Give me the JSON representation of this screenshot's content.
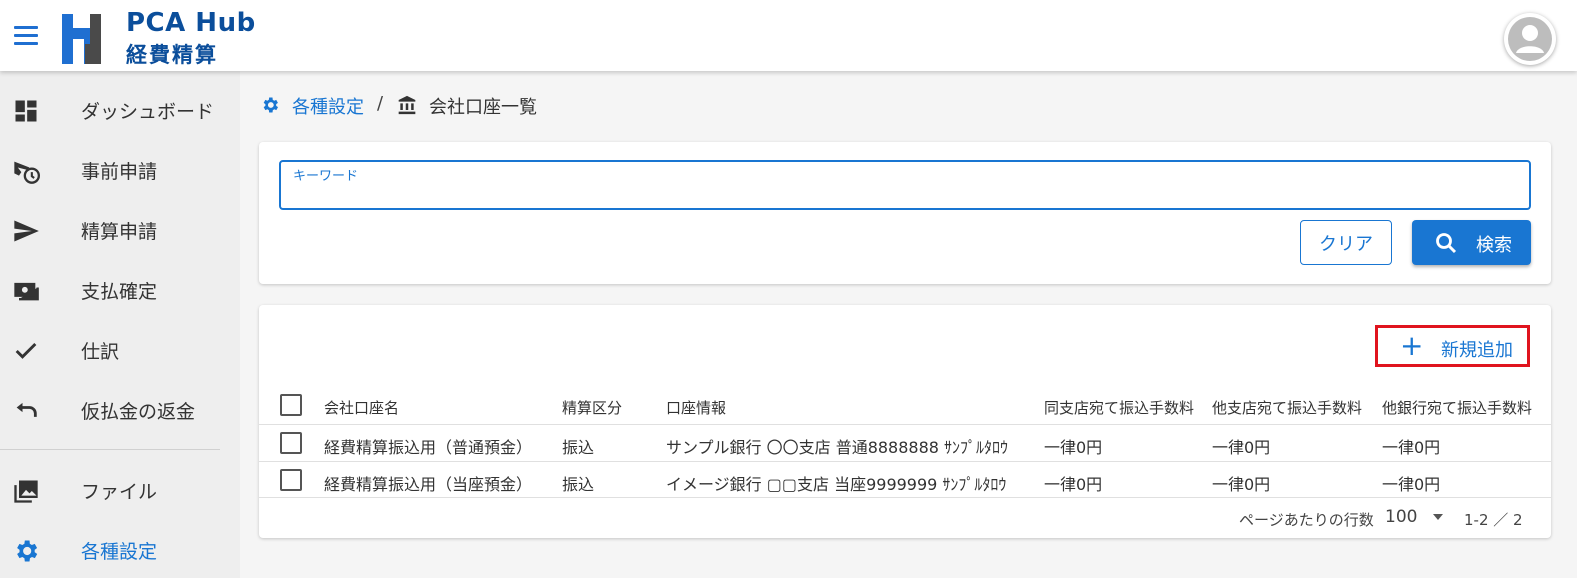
{
  "header": {
    "logo_line1": "PCA Hub",
    "logo_line2": "経費精算",
    "brand_color": "#0b4e9b"
  },
  "sidebar": {
    "items": [
      {
        "label": "ダッシュボード",
        "icon": "dashboard-icon"
      },
      {
        "label": "事前申請",
        "icon": "send-clock-icon"
      },
      {
        "label": "精算申請",
        "icon": "send-icon"
      },
      {
        "label": "支払確定",
        "icon": "payments-icon"
      },
      {
        "label": "仕訳",
        "icon": "check-icon"
      },
      {
        "label": "仮払金の返金",
        "icon": "undo-icon"
      },
      {
        "label": "ファイル",
        "icon": "photo-library-icon"
      },
      {
        "label": "各種設定",
        "icon": "gear-icon",
        "active": true
      }
    ]
  },
  "breadcrumb": {
    "parent": "各種設定",
    "separator": "/",
    "current": "会社口座一覧"
  },
  "search": {
    "keyword_label": "キーワード",
    "keyword_value": "",
    "clear_label": "クリア",
    "search_label": "検索"
  },
  "table": {
    "add_label": "新規追加",
    "columns": [
      "会社口座名",
      "精算区分",
      "口座情報",
      "同支店宛て振込手数料",
      "他支店宛て振込手数料",
      "他銀行宛て振込手数料"
    ],
    "rows": [
      [
        "経費精算振込用（普通預金）",
        "振込",
        "サンプル銀行 〇〇支店 普通8888888 ｻﾝﾌﾟﾙﾀﾛｳ",
        "一律0円",
        "一律0円",
        "一律0円"
      ],
      [
        "経費精算振込用（当座預金）",
        "振込",
        "イメージ銀行 ▢▢支店 当座9999999 ｻﾝﾌﾟﾙﾀﾛｳ",
        "一律0円",
        "一律0円",
        "一律0円"
      ]
    ]
  },
  "pagination": {
    "rows_per_page_label": "ページあたりの行数",
    "rows_per_page": "100",
    "range": "1-2 ／ 2"
  },
  "colors": {
    "accent": "#1976d2",
    "highlight": "#e0141e"
  }
}
